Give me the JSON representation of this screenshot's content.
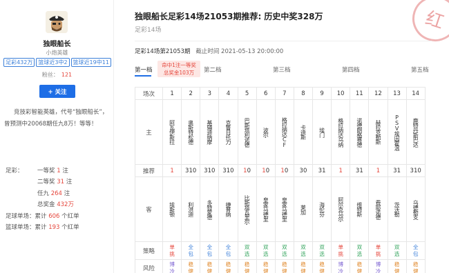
{
  "profile": {
    "name": "独眼船长",
    "title": "小炮英雄",
    "badges": [
      "足彩432万",
      "篮球近3中2",
      "篮球近19中11"
    ],
    "fans_label": "粉丝：",
    "fans_count": "121",
    "follow_label": "+ 关注",
    "description": "竞技彩智能英雄，代号“独眼船长”，曾预测中20068期任九8万！等等！"
  },
  "stats": {
    "football_label": "足彩：",
    "first_prize_label": "一等奖",
    "first_prize_count": "1",
    "second_prize_label": "二等奖",
    "second_prize_count": "31",
    "renjiu_label": "任九",
    "renjiu_count": "264",
    "total_label": "总奖金",
    "total_amount": "432万",
    "fb_single_label": "足球单场：",
    "fb_single_prefix": "累计",
    "fb_single_count": "606",
    "fb_single_suffix": "个红单",
    "bb_single_label": "篮球单场：",
    "bb_single_prefix": "累计",
    "bb_single_count": "193",
    "bb_single_suffix": "个红单",
    "unit_zhu": "注"
  },
  "article": {
    "title": "独眼船长足彩14场21053期推荐: 历史中奖328万",
    "subtitle": "足彩14场",
    "stamp": "红",
    "issue": "足彩14场第21053期",
    "deadline": "截止时间 2021-05-13 20:00:00",
    "hit_line1": "命中1注一等奖",
    "hit_line2": "总奖金103万"
  },
  "tabs": [
    "第一档",
    "第二档",
    "第三档",
    "第四档",
    "第五档"
  ],
  "table": {
    "row_labels": {
      "match": "场次",
      "home": "主",
      "pick": "推荐",
      "away": "客",
      "strategy": "策略",
      "risk": "风险"
    },
    "matches": [
      {
        "n": "1",
        "home": "阿瓦伊斯拉",
        "away": "埃斯顿",
        "pick": [
          "1"
        ],
        "strategy": [
          "单",
          "挑"
        ],
        "risk": [
          "博",
          "冷"
        ]
      },
      {
        "n": "2",
        "home": "奥斯特松德",
        "away": "利洪迪",
        "pick": [
          "3",
          "1",
          "0"
        ],
        "strategy": [
          "全",
          "包"
        ],
        "risk": [
          "稳",
          "健"
        ]
      },
      {
        "n": "3",
        "home": "基辅迪纳摩",
        "away": "多特蒙德",
        "pick": [
          "3",
          "1",
          "0"
        ],
        "strategy": [
          "全",
          "包"
        ],
        "risk": [
          "稳",
          "健"
        ]
      },
      {
        "n": "4",
        "home": "克鲁日托力",
        "away": "捷普纳",
        "pick": [
          "3",
          "1",
          "0"
        ],
        "strategy": [
          "全",
          "包"
        ],
        "risk": [
          "稳",
          "健"
        ]
      },
      {
        "n": "5",
        "home": "巴斯塔利诺德",
        "away": "比斯塔瓦里尔",
        "pick": [
          "1",
          "0"
        ],
        "strategy": [
          "双",
          "选"
        ],
        "risk": [
          "稳",
          "健"
        ]
      },
      {
        "n": "6",
        "home": "波尔",
        "away": "皇家马德里",
        "pick": [
          "1",
          "0"
        ],
        "strategy": [
          "双",
          "选"
        ],
        "risk": [
          "稳",
          "健"
        ]
      },
      {
        "n": "7",
        "home": "格拉纳达CF",
        "away": "皇家马德里",
        "pick": [
          "1",
          "0"
        ],
        "strategy": [
          "双",
          "选"
        ],
        "risk": [
          "稳",
          "健"
        ]
      },
      {
        "n": "8",
        "home": "卡迪斯",
        "away": "莱加",
        "pick": [
          "3",
          "0"
        ],
        "strategy": [
          "双",
          "选"
        ],
        "risk": [
          "稳",
          "健"
        ]
      },
      {
        "n": "9",
        "home": "埃门",
        "away": "海伦芬",
        "pick": [
          "3",
          "1"
        ],
        "strategy": [
          "双",
          "选"
        ],
        "risk": [
          "稳",
          "健"
        ]
      },
      {
        "n": "10",
        "home": "格拉纳达乌纳",
        "away": "阿尔克马尔",
        "pick": [
          "1"
        ],
        "strategy": [
          "单",
          "挑"
        ],
        "risk": [
          "博",
          "冷"
        ]
      },
      {
        "n": "11",
        "home": "诺德朗格赛德",
        "away": "维特斯",
        "pick": [
          "3",
          "1"
        ],
        "strategy": [
          "双",
          "选"
        ],
        "risk": [
          "稳",
          "健"
        ]
      },
      {
        "n": "12",
        "home": "赫拉克勒斯",
        "away": "费耶诺德",
        "pick": [
          "1"
        ],
        "strategy": [
          "单",
          "挑"
        ],
        "risk": [
          "博",
          "冷"
        ]
      },
      {
        "n": "13",
        "home": "PSV埃因霍温",
        "away": "茨沃勒",
        "pick": [
          "3",
          "1"
        ],
        "strategy": [
          "双",
          "选"
        ],
        "risk": [
          "稳",
          "健"
        ]
      },
      {
        "n": "14",
        "home": "鹿特丹斯巴达",
        "away": "乌德勒支",
        "pick": [
          "3",
          "1",
          "0"
        ],
        "strategy": [
          "全",
          "包"
        ],
        "risk": [
          "稳",
          "健"
        ]
      }
    ]
  }
}
